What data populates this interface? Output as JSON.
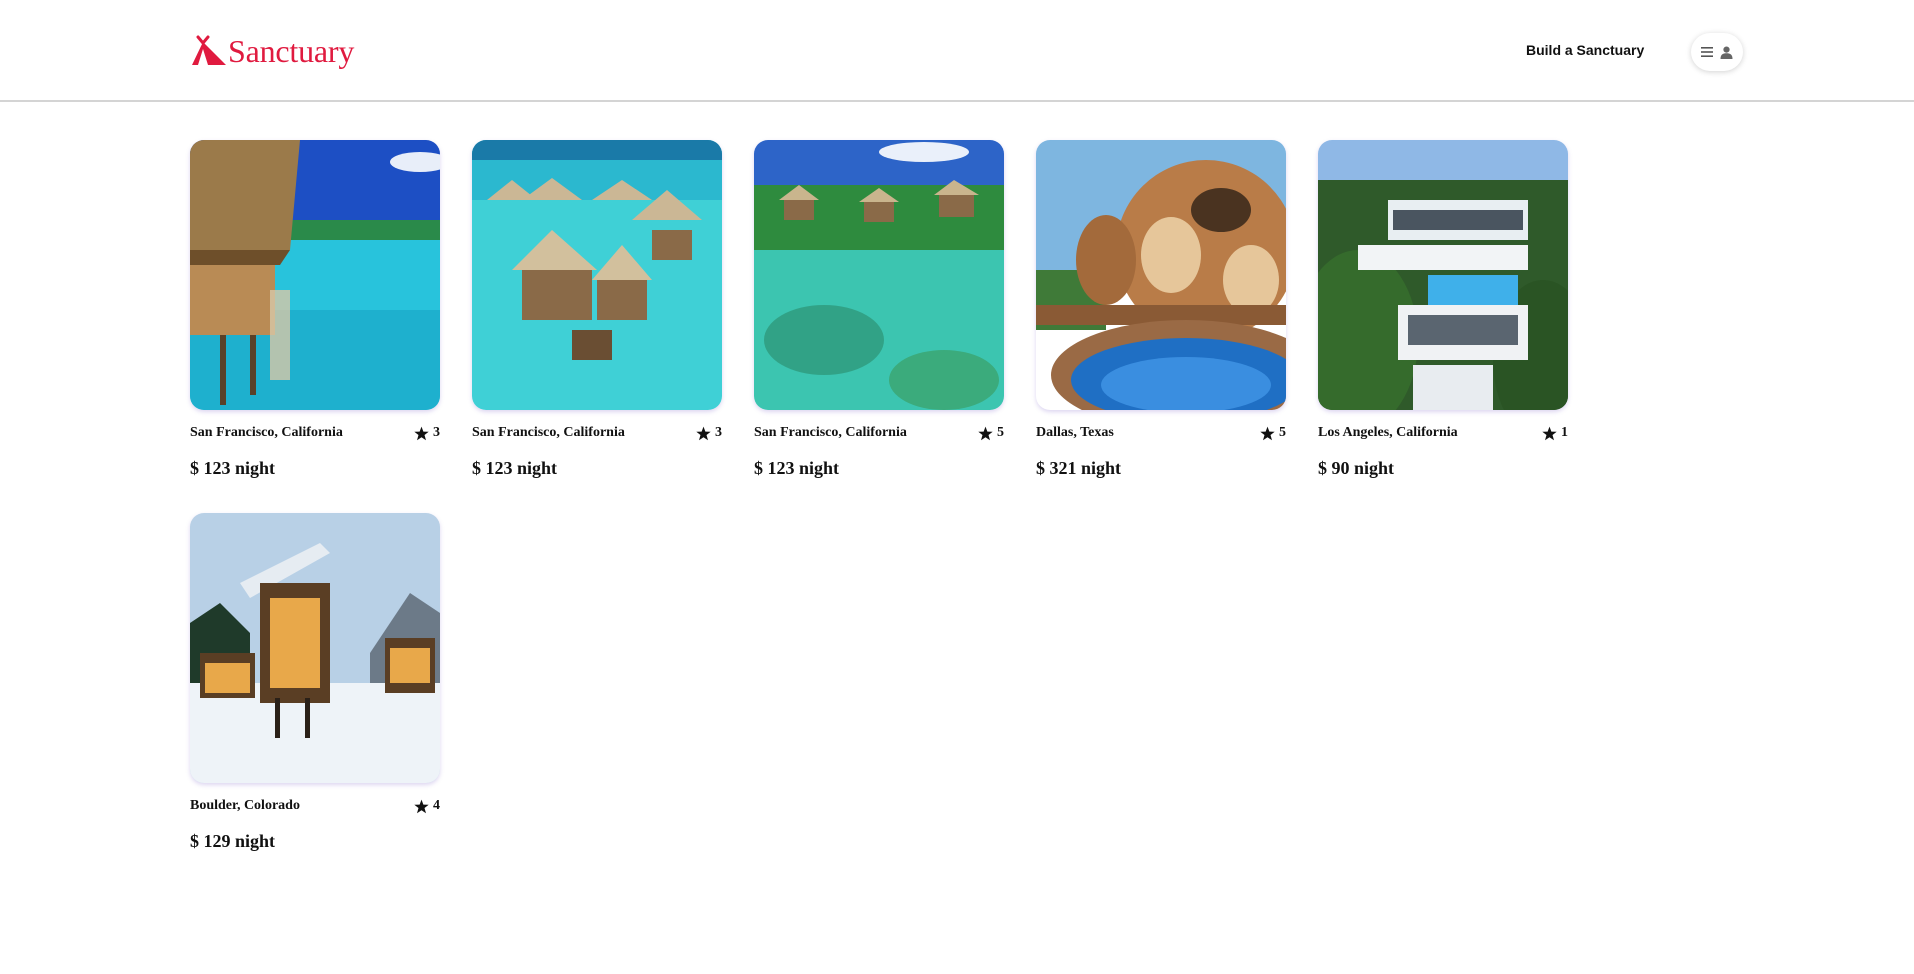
{
  "brand": {
    "name": "Sanctuary",
    "color": "#e01a3f",
    "icon": "tent-icon"
  },
  "nav": {
    "build_label": "Build a Sanctuary",
    "menu_icon": "hamburger-menu-icon",
    "user_icon": "user-icon"
  },
  "listings": [
    {
      "location": "San Francisco, California",
      "rating": "3",
      "price": "$ 123 night",
      "image": "overwater-bungalow-photo"
    },
    {
      "location": "San Francisco, California",
      "rating": "3",
      "price": "$ 123 night",
      "image": "overwater-villas-photo"
    },
    {
      "location": "San Francisco, California",
      "rating": "5",
      "price": "$ 123 night",
      "image": "lagoon-huts-photo"
    },
    {
      "location": "Dallas, Texas",
      "rating": "5",
      "price": "$ 321 night",
      "image": "bubble-house-photo"
    },
    {
      "location": "Los Angeles, California",
      "rating": "1",
      "price": "$ 90 night",
      "image": "hillside-mansion-photo"
    },
    {
      "location": "Boulder, Colorado",
      "rating": "4",
      "price": "$ 129 night",
      "image": "snow-cabin-photo"
    }
  ],
  "star_icon": "star-icon"
}
